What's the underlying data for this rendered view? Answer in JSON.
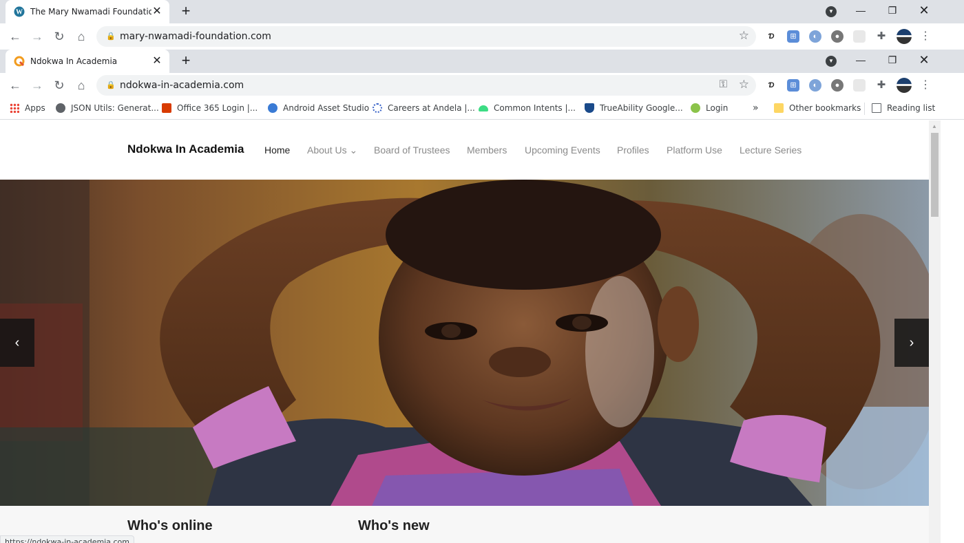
{
  "back_window": {
    "tab_title": "The Mary Nwamadi Foundation –",
    "url": "mary-nwamadi-foundation.com"
  },
  "front_window": {
    "tab_title": "Ndokwa In Academia",
    "url": "ndokwa-in-academia.com"
  },
  "bookmarks": [
    {
      "label": "Apps",
      "icon": "apps-grid-icon"
    },
    {
      "label": "JSON Utils: Generat...",
      "icon": "globe-icon"
    },
    {
      "label": "Office 365 Login |...",
      "icon": "office-icon"
    },
    {
      "label": "Android Asset Studio",
      "icon": "android-studio-icon"
    },
    {
      "label": "Careers at Andela |...",
      "icon": "andela-icon"
    },
    {
      "label": "Common Intents  |...",
      "icon": "android-icon"
    },
    {
      "label": "TrueAbility Google...",
      "icon": "shield-icon"
    },
    {
      "label": "Login",
      "icon": "login-icon"
    }
  ],
  "bookmarks_overflow": "»",
  "other_bookmarks": "Other bookmarks",
  "reading_list": "Reading list",
  "site": {
    "brand": "Ndokwa In Academia",
    "menu": [
      {
        "label": "Home"
      },
      {
        "label": "About Us ⌄"
      },
      {
        "label": "Board of Trustees"
      },
      {
        "label": "Members"
      },
      {
        "label": "Upcoming Events"
      },
      {
        "label": "Profiles"
      },
      {
        "label": "Platform Use"
      },
      {
        "label": "Lecture Series"
      }
    ],
    "slider_prev": "‹",
    "slider_next": "›",
    "section_1": "Who's online",
    "section_2": "Who's new"
  },
  "status_url": "https://ndokwa-in-academia.com"
}
